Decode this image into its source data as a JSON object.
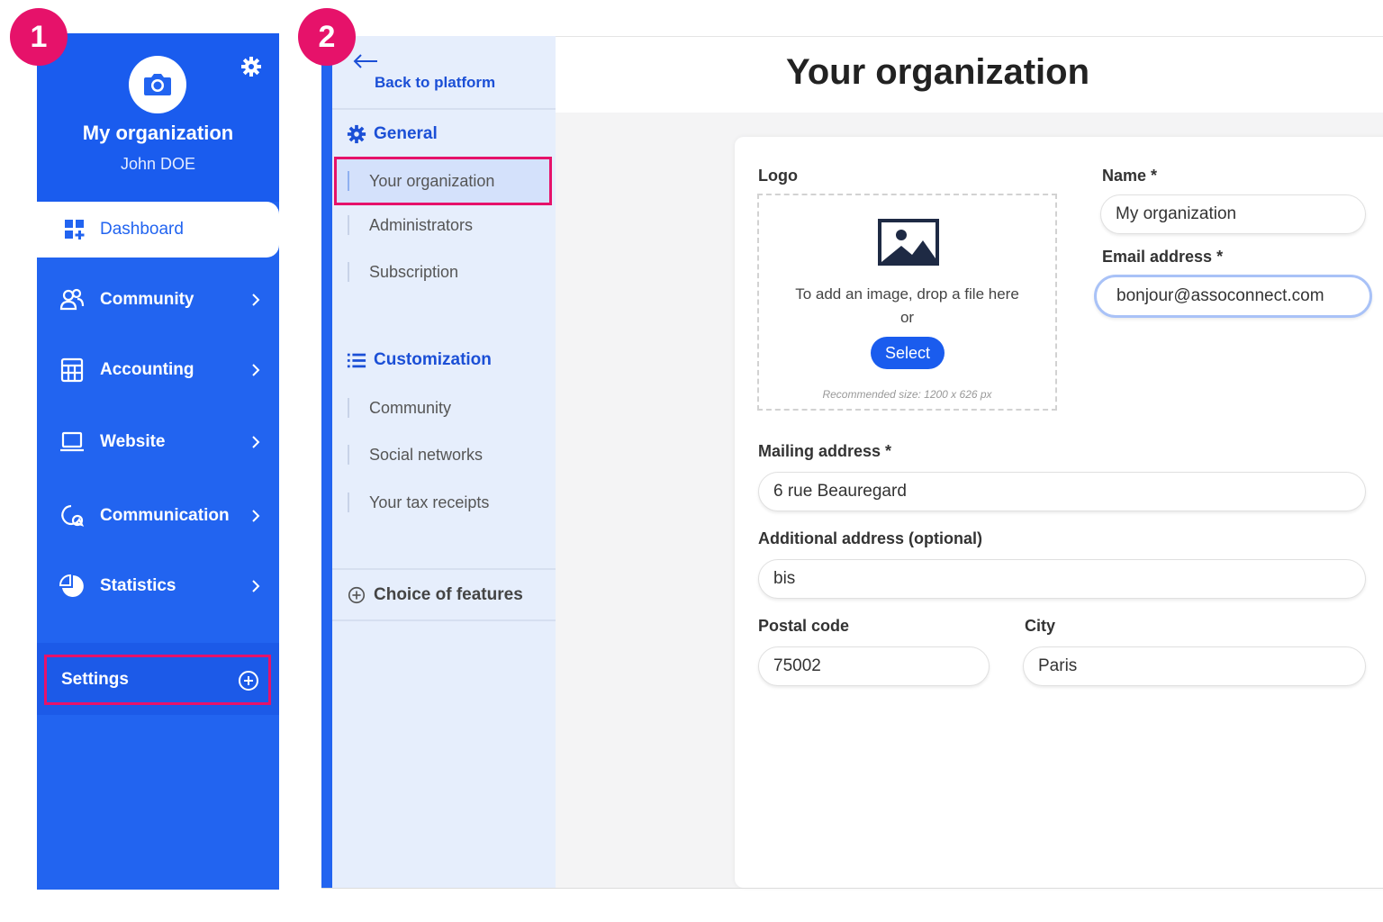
{
  "badges": {
    "step1": "1",
    "step2": "2"
  },
  "sidebar": {
    "org_name": "My organization",
    "user_name": "John DOE",
    "dashboard": "Dashboard",
    "items": [
      {
        "label": "Community",
        "icon": "community-icon"
      },
      {
        "label": "Accounting",
        "icon": "accounting-icon"
      },
      {
        "label": "Website",
        "icon": "laptop-icon"
      },
      {
        "label": "Communication",
        "icon": "chat-icon"
      },
      {
        "label": "Statistics",
        "icon": "pie-chart-icon"
      }
    ],
    "settings": "Settings"
  },
  "subnav": {
    "back": "Back to platform",
    "general": "General",
    "general_items": [
      "Your organization",
      "Administrators",
      "Subscription"
    ],
    "customization": "Customization",
    "customization_items": [
      "Community",
      "Social networks",
      "Your tax receipts"
    ],
    "features": "Choice of features"
  },
  "page": {
    "title": "Your organization"
  },
  "form": {
    "logo_label": "Logo",
    "drop_text": "To add an image, drop a file here",
    "drop_or": "or",
    "select_button": "Select",
    "recommended": "Recommended size: 1200 x 626 px",
    "name_label": "Name *",
    "name_value": "My organization",
    "email_label": "Email address *",
    "email_value": "bonjour@assoconnect.com",
    "mailing_label": "Mailing address *",
    "mailing_value": "6 rue Beauregard",
    "additional_label": "Additional address (optional)",
    "additional_value": "bis",
    "postal_label": "Postal code",
    "postal_value": "75002",
    "city_label": "City",
    "city_value": "Paris"
  },
  "colors": {
    "primary": "#2264f0",
    "highlight": "#e6126a",
    "subnav_bg": "#e6eefc"
  }
}
